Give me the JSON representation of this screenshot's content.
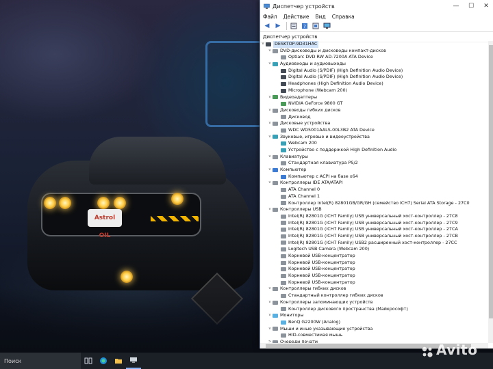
{
  "window": {
    "title": "Диспетчер устройств",
    "controls": {
      "minimize": "—",
      "maximize": "☐",
      "close": "✕"
    }
  },
  "menu": [
    "Файл",
    "Действие",
    "Вид",
    "Справка"
  ],
  "toolbar_icons": [
    "back-icon",
    "forward-icon",
    "properties-icon",
    "help-icon",
    "update-driver-icon",
    "monitor-icon"
  ],
  "tree_header": "Диспетчер устройств",
  "tree": {
    "root": "DESKTOP-9D31HAC",
    "rows": [
      {
        "level": 1,
        "exp": "v",
        "icon": "gray",
        "text": "DVD-дисководы и дисководы компакт-дисков"
      },
      {
        "level": 2,
        "exp": "",
        "icon": "gray",
        "text": "Optiarc DVD RW AD-7200A ATA Device"
      },
      {
        "level": 1,
        "exp": "v",
        "icon": "teal",
        "text": "Аудиовходы и аудиовыходы"
      },
      {
        "level": 2,
        "exp": "",
        "icon": "dark",
        "text": "Digital Audio (S/PDIF) (High Definition Audio Device)"
      },
      {
        "level": 2,
        "exp": "",
        "icon": "dark",
        "text": "Digital Audio (S/PDIF) (High Definition Audio Device)"
      },
      {
        "level": 2,
        "exp": "",
        "icon": "dark",
        "text": "Headphones (High Definition Audio Device)"
      },
      {
        "level": 2,
        "exp": "",
        "icon": "dark",
        "text": "Microphone (Webcam 200)"
      },
      {
        "level": 1,
        "exp": "v",
        "icon": "green",
        "text": "Видеоадаптеры"
      },
      {
        "level": 2,
        "exp": "",
        "icon": "green",
        "text": "NVIDIA GeForce 9800 GT"
      },
      {
        "level": 1,
        "exp": "v",
        "icon": "gray",
        "text": "Дисководы гибких дисков"
      },
      {
        "level": 2,
        "exp": "",
        "icon": "gray",
        "text": "Дисковод"
      },
      {
        "level": 1,
        "exp": "v",
        "icon": "gray",
        "text": "Дисковые устройства"
      },
      {
        "level": 2,
        "exp": "",
        "icon": "gray",
        "text": "WDC WD5001AALS-00L3B2 ATA Device"
      },
      {
        "level": 1,
        "exp": "v",
        "icon": "teal",
        "text": "Звуковые, игровые и видеоустройства"
      },
      {
        "level": 2,
        "exp": "",
        "icon": "teal",
        "text": "Webcam 200"
      },
      {
        "level": 2,
        "exp": "",
        "icon": "teal",
        "text": "Устройство с поддержкой High Definition Audio"
      },
      {
        "level": 1,
        "exp": "v",
        "icon": "gray",
        "text": "Клавиатуры"
      },
      {
        "level": 2,
        "exp": "",
        "icon": "gray",
        "text": "Стандартная клавиатура PS/2"
      },
      {
        "level": 1,
        "exp": "v",
        "icon": "blue",
        "text": "Компьютер"
      },
      {
        "level": 2,
        "exp": "",
        "icon": "blue",
        "text": "Компьютер с ACPI на базе x64"
      },
      {
        "level": 1,
        "exp": "v",
        "icon": "gray",
        "text": "Контроллеры IDE ATA/ATAPI"
      },
      {
        "level": 2,
        "exp": "",
        "icon": "gray",
        "text": "ATA Channel 0"
      },
      {
        "level": 2,
        "exp": "",
        "icon": "gray",
        "text": "ATA Channel 1"
      },
      {
        "level": 2,
        "exp": "",
        "icon": "gray",
        "text": "Контроллер Intel(R) 82801GB/GR/GH (семейство ICH7) Serial ATA Storage - 27C0"
      },
      {
        "level": 1,
        "exp": "v",
        "icon": "gray",
        "text": "Контроллеры USB"
      },
      {
        "level": 2,
        "exp": "",
        "icon": "gray",
        "text": "Intel(R) 82801G (ICH7 Family) USB универсальный хост-контроллер - 27C8"
      },
      {
        "level": 2,
        "exp": "",
        "icon": "gray",
        "text": "Intel(R) 82801G (ICH7 Family) USB универсальный хост-контроллер - 27C9"
      },
      {
        "level": 2,
        "exp": "",
        "icon": "gray",
        "text": "Intel(R) 82801G (ICH7 Family) USB универсальный хост-контроллер - 27CA"
      },
      {
        "level": 2,
        "exp": "",
        "icon": "gray",
        "text": "Intel(R) 82801G (ICH7 Family) USB универсальный хост-контроллер - 27CB"
      },
      {
        "level": 2,
        "exp": "",
        "icon": "gray",
        "text": "Intel(R) 82801G (ICH7 Family) USB2 расширенный хост-контроллер - 27CC"
      },
      {
        "level": 2,
        "exp": "",
        "icon": "gray",
        "text": "Logitech USB Camera (Webcam 200)"
      },
      {
        "level": 2,
        "exp": "",
        "icon": "gray",
        "text": "Корневой USB-концентратор"
      },
      {
        "level": 2,
        "exp": "",
        "icon": "gray",
        "text": "Корневой USB-концентратор"
      },
      {
        "level": 2,
        "exp": "",
        "icon": "gray",
        "text": "Корневой USB-концентратор"
      },
      {
        "level": 2,
        "exp": "",
        "icon": "gray",
        "text": "Корневой USB-концентратор"
      },
      {
        "level": 2,
        "exp": "",
        "icon": "gray",
        "text": "Корневой USB-концентратор"
      },
      {
        "level": 1,
        "exp": "v",
        "icon": "gray",
        "text": "Контроллеры гибких дисков"
      },
      {
        "level": 2,
        "exp": "",
        "icon": "gray",
        "text": "Стандартный контроллер гибких дисков"
      },
      {
        "level": 1,
        "exp": "v",
        "icon": "gray",
        "text": "Контроллеры запоминающих устройств"
      },
      {
        "level": 2,
        "exp": "",
        "icon": "gray",
        "text": "Контроллер дискового пространства (Майкрософт)"
      },
      {
        "level": 1,
        "exp": "v",
        "icon": "cyan",
        "text": "Мониторы"
      },
      {
        "level": 2,
        "exp": "",
        "icon": "cyan",
        "text": "BenQ G2200W (Analog)"
      },
      {
        "level": 1,
        "exp": "v",
        "icon": "gray",
        "text": "Мыши и иные указывающие устройства"
      },
      {
        "level": 2,
        "exp": "",
        "icon": "gray",
        "text": "HID-совместимая мышь"
      },
      {
        "level": 1,
        "exp": ">",
        "icon": "gray",
        "text": "Очереди печати"
      }
    ]
  },
  "taskbar": {
    "search_text": "Поиск",
    "icons": [
      "task-view-icon",
      "edge-icon",
      "file-explorer-icon",
      "device-manager-icon"
    ]
  },
  "wallpaper": {
    "logo_text": "Astrol OIL"
  },
  "watermark": "Avito",
  "colors": {
    "selection": "#cfe2f7",
    "taskbar": "#1b1f26",
    "accent": "#3c7bd1"
  }
}
